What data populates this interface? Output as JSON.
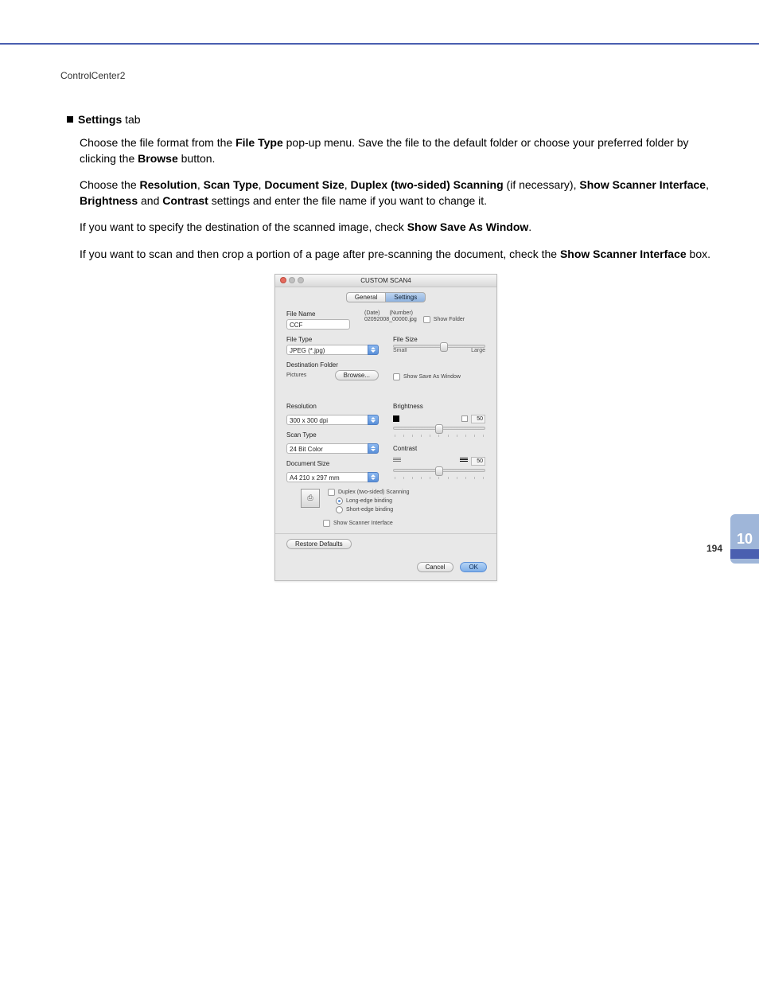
{
  "page": {
    "header": "ControlCenter2",
    "chapter": "10",
    "number": "194"
  },
  "text": {
    "heading_bold": "Settings",
    "heading_rest": " tab",
    "p1_a": "Choose the file format from the ",
    "p1_b": "File Type",
    "p1_c": " pop-up menu. Save the file to the default folder or choose your preferred folder by clicking the ",
    "p1_d": "Browse",
    "p1_e": " button.",
    "p2_a": "Choose the ",
    "p2_b": "Resolution",
    "p2_c": ", ",
    "p2_d": "Scan Type",
    "p2_e": ", ",
    "p2_f": "Document Size",
    "p2_g": ", ",
    "p2_h": "Duplex (two-sided) Scanning",
    "p2_i": " (if necessary), ",
    "p2_j": "Show Scanner Interface",
    "p2_k": ", ",
    "p2_l": "Brightness",
    "p2_m": " and ",
    "p2_n": "Contrast",
    "p2_o": " settings and enter the file name if you want to change it.",
    "p3_a": "If you want to specify the destination of the scanned image, check ",
    "p3_b": "Show Save As Window",
    "p3_c": ".",
    "p4_a": "If you want to scan and then crop a portion of a page after pre-scanning the document, check the ",
    "p4_b": "Show Scanner Interface",
    "p4_c": " box."
  },
  "dialog": {
    "title": "CUSTOM SCAN4",
    "tab_general": "General",
    "tab_settings": "Settings",
    "file_name_label": "File Name",
    "file_name_value": "CCF",
    "date_label": "(Date)",
    "number_label": "(Number)",
    "generated_name": "02092008_00000.jpg",
    "show_folder": "Show Folder",
    "file_type_label": "File Type",
    "file_type_value": "JPEG (*.jpg)",
    "file_size_label": "File Size",
    "file_size_small": "Small",
    "file_size_large": "Large",
    "dest_folder_label": "Destination Folder",
    "dest_folder_value": "Pictures",
    "browse": "Browse...",
    "show_save_as": "Show Save As Window",
    "resolution_label": "Resolution",
    "resolution_value": "300 x 300 dpi",
    "scan_type_label": "Scan Type",
    "scan_type_value": "24 Bit Color",
    "document_size_label": "Document Size",
    "document_size_value": "A4  210 x 297 mm",
    "brightness_label": "Brightness",
    "brightness_value": "50",
    "contrast_label": "Contrast",
    "contrast_value": "50",
    "duplex": "Duplex (two-sided) Scanning",
    "long_edge": "Long-edge binding",
    "short_edge": "Short-edge binding",
    "show_scanner_interface": "Show Scanner Interface",
    "restore_defaults": "Restore Defaults",
    "cancel": "Cancel",
    "ok": "OK"
  }
}
